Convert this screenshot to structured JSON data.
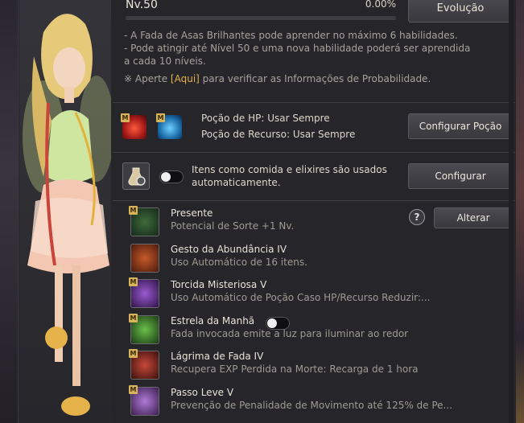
{
  "level": {
    "text": "Nv.50",
    "percent": "0.00%",
    "progress": 0
  },
  "buttons": {
    "evolution": "Evolução",
    "configure_potion": "Configurar Poção",
    "configure": "Configurar",
    "change": "Alterar"
  },
  "notes": {
    "line1": "- A Fada de Asas Brilhantes pode aprender no máximo 6 habilidades.",
    "line2": "- Pode atingir até Nível 50 e uma nova habilidade poderá ser aprendida a cada 10 níveis.",
    "info_prefix": "※ Aperte ",
    "info_link": "[Aqui]",
    "info_suffix": " para verificar as Informações de Probabilidade."
  },
  "potions": {
    "hp": "Poção de HP: Usar Sempre",
    "resource": "Poção de Recurso: Usar Sempre"
  },
  "auto_items": {
    "label": "Itens como comida e elixires são usados automaticamente.",
    "enabled": false
  },
  "badge": "M",
  "help": "?",
  "skills": [
    {
      "name": "Presente",
      "desc": "Potencial de Sorte +1 Nv."
    },
    {
      "name": "Gesto da Abundância IV",
      "desc": "Uso Automático de 16 itens."
    },
    {
      "name": "Torcida Misteriosa V",
      "desc": "Uso Automático de Poção Caso HP/Recurso Reduzir:..."
    },
    {
      "name": "Estrela da Manhã",
      "desc": "Fada invocada emite a luz para iluminar ao redor",
      "toggle": false
    },
    {
      "name": "Lágrima de Fada IV",
      "desc": "Recupera EXP Perdida na Morte: Recarga de 1 hora"
    },
    {
      "name": "Passo Leve V",
      "desc": "Prevenção de Penalidade de Movimento até 125% de Pe..."
    }
  ],
  "colors": {
    "accent_link": "#e2b04a",
    "badge": "#d7b45a",
    "panel": "#25252a"
  }
}
